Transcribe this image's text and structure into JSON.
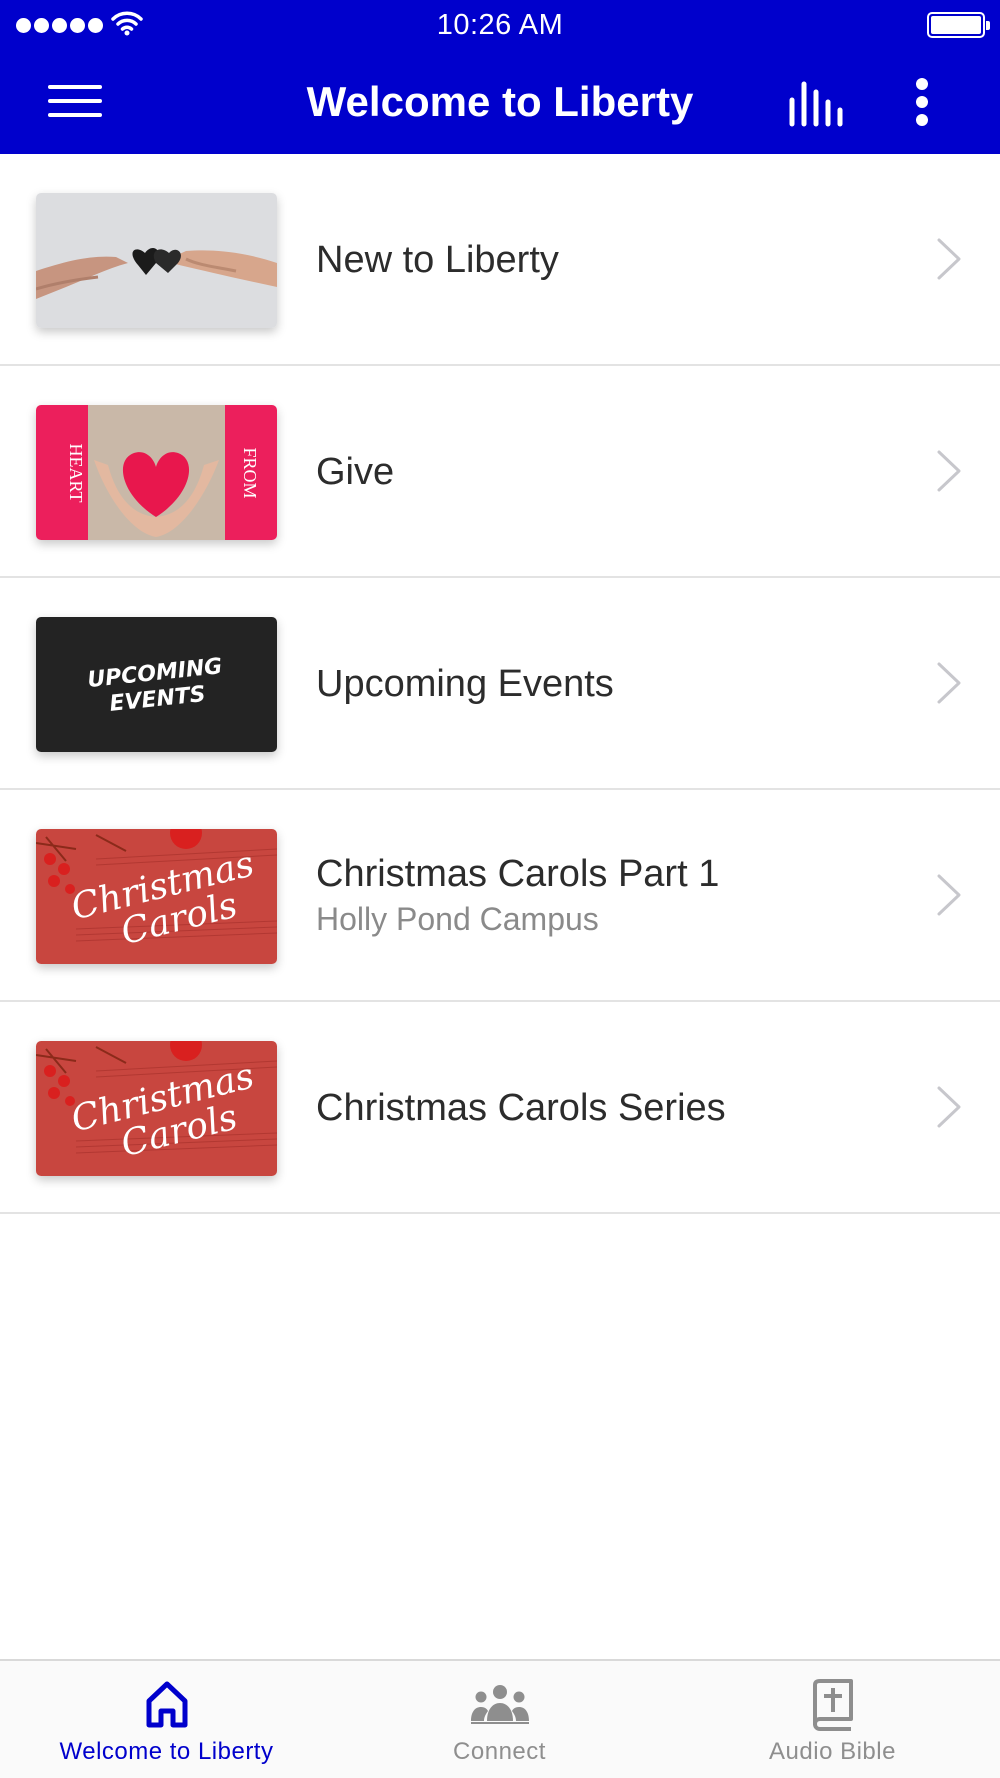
{
  "status_bar": {
    "time": "10:26 AM",
    "signal_icon": "cellular-signal-icon",
    "wifi_icon": "wifi-icon",
    "battery_icon": "battery-full-icon"
  },
  "nav": {
    "title": "Welcome to Liberty",
    "menu_icon": "hamburger-menu-icon",
    "stats_icon": "audio-levels-icon",
    "more_icon": "more-vertical-icon"
  },
  "list": [
    {
      "title": "New to Liberty",
      "subtitle": "",
      "thumbnail": "hands-heart-image"
    },
    {
      "title": "Give",
      "subtitle": "",
      "thumbnail": "heart-from-heart-image",
      "thumb_text": [
        "HEART",
        "FROM"
      ]
    },
    {
      "title": "Upcoming Events",
      "subtitle": "",
      "thumbnail": "upcoming-events-image",
      "thumb_text": [
        "UPCOMING",
        "EVENTS"
      ]
    },
    {
      "title": "Christmas Carols Part 1",
      "subtitle": "Holly Pond Campus",
      "thumbnail": "christmas-carols-image",
      "thumb_text": [
        "Christmas",
        "Carols"
      ]
    },
    {
      "title": "Christmas Carols Series",
      "subtitle": "",
      "thumbnail": "christmas-carols-image",
      "thumb_text": [
        "Christmas",
        "Carols"
      ]
    }
  ],
  "tabs": [
    {
      "label": "Welcome to Liberty",
      "icon": "home-icon",
      "active": true
    },
    {
      "label": "Connect",
      "icon": "group-icon",
      "active": false
    },
    {
      "label": "Audio Bible",
      "icon": "bible-icon",
      "active": false
    }
  ],
  "colors": {
    "brand": "#0000cc",
    "tab_inactive": "#8e8e8e",
    "text_primary": "#2c2c2c",
    "text_secondary": "#8a8a8a"
  }
}
